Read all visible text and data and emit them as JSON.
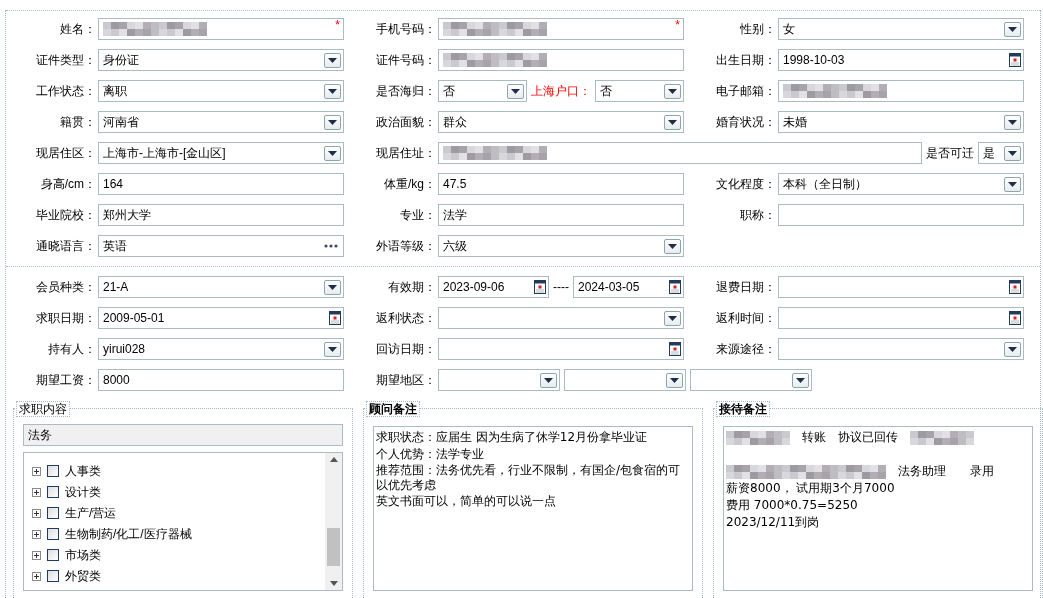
{
  "personal_section": {
    "rows": [
      [
        {
          "label": "姓名：",
          "controls": [
            {
              "kind": "text",
              "redacted": true,
              "required_mark": "*"
            }
          ]
        },
        {
          "label": "手机号码：",
          "controls": [
            {
              "kind": "text",
              "redacted": true,
              "required_mark": "*"
            }
          ]
        },
        {
          "label": "性别：",
          "controls": [
            {
              "kind": "select",
              "value": "女"
            }
          ]
        }
      ],
      [
        {
          "label": "证件类型：",
          "controls": [
            {
              "kind": "select",
              "value": "身份证"
            }
          ]
        },
        {
          "label": "证件号码：",
          "controls": [
            {
              "kind": "text",
              "redacted": true
            }
          ]
        },
        {
          "label": "出生日期：",
          "controls": [
            {
              "kind": "date",
              "value": "1998-10-03"
            }
          ]
        }
      ],
      [
        {
          "label": "工作状态：",
          "controls": [
            {
              "kind": "select",
              "value": "离职"
            }
          ]
        },
        {
          "label": "是否海归：",
          "controls": [
            {
              "kind": "select",
              "value": "否"
            },
            {
              "kind": "label",
              "text": "上海户口：",
              "emphasis": true
            },
            {
              "kind": "select",
              "value": "否"
            }
          ]
        },
        {
          "label": "电子邮箱：",
          "controls": [
            {
              "kind": "text",
              "redacted": true
            }
          ]
        }
      ],
      [
        {
          "label": "籍贯：",
          "controls": [
            {
              "kind": "select",
              "value": "河南省"
            }
          ]
        },
        {
          "label": "政治面貌：",
          "controls": [
            {
              "kind": "select",
              "value": "群众"
            }
          ]
        },
        {
          "label": "婚育状况：",
          "controls": [
            {
              "kind": "select",
              "value": "未婚"
            }
          ]
        }
      ],
      [
        {
          "label": "现居住区：",
          "controls": [
            {
              "kind": "select",
              "value": "上海市-上海市-[金山区]"
            }
          ]
        },
        {
          "label": "现居住址：",
          "wide": true,
          "controls": [
            {
              "kind": "text",
              "redacted": true
            },
            {
              "kind": "label",
              "text": "是否可迁",
              "emphasis": false
            },
            {
              "kind": "compact-select",
              "value": "是"
            }
          ]
        }
      ],
      [
        {
          "label": "身高/cm：",
          "controls": [
            {
              "kind": "text",
              "value": "164"
            }
          ]
        },
        {
          "label": "体重/kg：",
          "controls": [
            {
              "kind": "text",
              "value": "47.5"
            }
          ]
        },
        {
          "label": "文化程度：",
          "controls": [
            {
              "kind": "select",
              "value": "本科（全日制）"
            }
          ]
        }
      ],
      [
        {
          "label": "毕业院校：",
          "controls": [
            {
              "kind": "text",
              "value": "郑州大学"
            }
          ]
        },
        {
          "label": "专业：",
          "controls": [
            {
              "kind": "text",
              "value": "法学"
            }
          ]
        },
        {
          "label": "职称：",
          "controls": [
            {
              "kind": "text"
            }
          ]
        }
      ],
      [
        {
          "label": "通晓语言：",
          "controls": [
            {
              "kind": "picker",
              "value": "英语"
            }
          ]
        },
        {
          "label": "外语等级：",
          "controls": [
            {
              "kind": "select",
              "value": "六级"
            }
          ]
        }
      ]
    ]
  },
  "membership_section": {
    "rows": [
      [
        {
          "label": "会员种类：",
          "controls": [
            {
              "kind": "select",
              "value": "21-A"
            }
          ]
        },
        {
          "label": "有效期：",
          "controls": [
            {
              "kind": "date",
              "value": "2023-09-06"
            },
            {
              "kind": "label",
              "text": "----",
              "emphasis": false
            },
            {
              "kind": "date",
              "value": "2024-03-05"
            }
          ]
        },
        {
          "label": "退费日期：",
          "controls": [
            {
              "kind": "date"
            }
          ]
        }
      ],
      [
        {
          "label": "求职日期：",
          "controls": [
            {
              "kind": "date",
              "value": "2009-05-01"
            }
          ]
        },
        {
          "label": "返利状态：",
          "controls": [
            {
              "kind": "select"
            }
          ]
        },
        {
          "label": "返利时间：",
          "controls": [
            {
              "kind": "date"
            }
          ]
        }
      ],
      [
        {
          "label": "持有人：",
          "controls": [
            {
              "kind": "select",
              "value": "yirui028"
            }
          ]
        },
        {
          "label": "回访日期：",
          "controls": [
            {
              "kind": "date"
            }
          ]
        },
        {
          "label": "来源途径：",
          "controls": [
            {
              "kind": "select"
            }
          ]
        }
      ],
      [
        {
          "label": "期望工资：",
          "controls": [
            {
              "kind": "text",
              "value": "8000"
            }
          ]
        },
        {
          "label": "期望地区：",
          "wide": true,
          "controls": [
            {
              "kind": "select"
            },
            {
              "kind": "select"
            },
            {
              "kind": "select"
            }
          ]
        }
      ]
    ]
  },
  "job_panel": {
    "title": "求职内容",
    "search": {
      "value": "法务"
    },
    "categories": [
      {
        "label": "人事类",
        "checked": false,
        "expanded": false
      },
      {
        "label": "设计类",
        "checked": false,
        "expanded": false
      },
      {
        "label": "生产/营运",
        "checked": false,
        "expanded": false
      },
      {
        "label": "生物制药/化工/医疗器械",
        "checked": false,
        "expanded": false
      },
      {
        "label": "市场类",
        "checked": false,
        "expanded": false
      },
      {
        "label": "外贸类",
        "checked": false,
        "expanded": false
      }
    ]
  },
  "advisor_notes": {
    "title": "顾问备注",
    "lines": [
      [
        {
          "text": "求职状态：应届生 因为生病了休学12月份拿毕业证"
        }
      ],
      [
        {
          "text": "个人优势：法学专业"
        }
      ],
      [
        {
          "text": "推荐范围：法务优先看，行业不限制，有国企/包食宿的可以优先考虑"
        }
      ],
      [
        {
          "text": "英文书面可以，简单的可以说一点"
        }
      ]
    ]
  },
  "reception_notes": {
    "title": "接待备注",
    "lines": [
      [
        {
          "redacted": true
        },
        {
          "text": "转账　协议已回传"
        },
        {
          "redacted": true
        }
      ],
      [
        {
          "redacted": true
        },
        {
          "text": "法务助理　　录用"
        }
      ],
      [
        {
          "text": "薪资8000， 试用期3个月7000"
        }
      ],
      [
        {
          "text": "费用 7000*0.75=5250"
        }
      ],
      [
        {
          "text": "2023/12/11到岗"
        }
      ]
    ]
  }
}
